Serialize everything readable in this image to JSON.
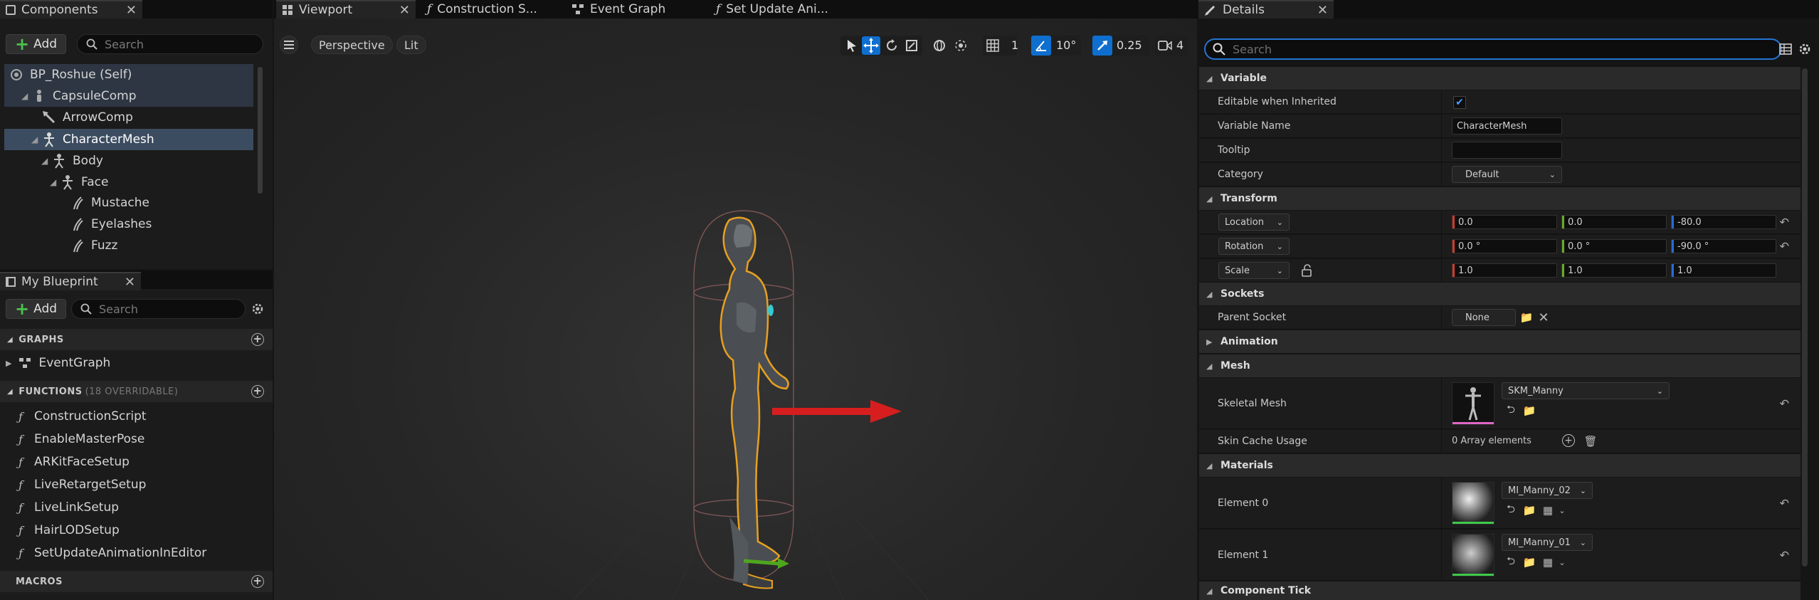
{
  "components_panel": {
    "tab_label": "Components",
    "add_label": "Add",
    "search_placeholder": "Search",
    "tree": [
      {
        "label": "BP_Roshue (Self)"
      },
      {
        "label": "CapsuleComp"
      },
      {
        "label": "ArrowComp"
      },
      {
        "label": "CharacterMesh"
      },
      {
        "label": "Body"
      },
      {
        "label": "Face"
      },
      {
        "label": "Mustache"
      },
      {
        "label": "Eyelashes"
      },
      {
        "label": "Fuzz"
      }
    ]
  },
  "my_blueprint": {
    "tab_label": "My Blueprint",
    "add_label": "Add",
    "search_placeholder": "Search",
    "graphs_header": "GRAPHS",
    "graphs": [
      {
        "label": "EventGraph"
      }
    ],
    "functions_header": "FUNCTIONS",
    "functions_count": "(18 OVERRIDABLE)",
    "functions": [
      {
        "label": "ConstructionScript"
      },
      {
        "label": "EnableMasterPose"
      },
      {
        "label": "ARKitFaceSetup"
      },
      {
        "label": "LiveRetargetSetup"
      },
      {
        "label": "LiveLinkSetup"
      },
      {
        "label": "HairLODSetup"
      },
      {
        "label": "SetUpdateAnimationInEditor"
      }
    ],
    "macros_header": "MACROS"
  },
  "editor_tabs": [
    {
      "label": "Viewport"
    },
    {
      "label": "Construction S..."
    },
    {
      "label": "Event Graph"
    },
    {
      "label": "Set Update Ani..."
    }
  ],
  "viewport": {
    "perspective_label": "Perspective",
    "lit_label": "Lit",
    "grid_snap_value": "1",
    "rotation_snap_value": "10°",
    "scale_snap_value": "0.25",
    "camera_speed_value": "4"
  },
  "details": {
    "tab_label": "Details",
    "search_placeholder": "Search",
    "sections": {
      "variable": "Variable",
      "transform": "Transform",
      "sockets": "Sockets",
      "animation": "Animation",
      "mesh": "Mesh",
      "materials": "Materials",
      "component_tick": "Component Tick"
    },
    "editable_when_inherited_label": "Editable when Inherited",
    "editable_when_inherited": true,
    "variable_name_label": "Variable Name",
    "variable_name": "CharacterMesh",
    "tooltip_label": "Tooltip",
    "tooltip": "",
    "category_label": "Category",
    "category": "Default",
    "location_label": "Location",
    "location": {
      "x": "0.0",
      "y": "0.0",
      "z": "-80.0"
    },
    "rotation_label": "Rotation",
    "rotation": {
      "x": "0.0 °",
      "y": "0.0 °",
      "z": "-90.0 °"
    },
    "scale_label": "Scale",
    "scale": {
      "x": "1.0",
      "y": "1.0",
      "z": "1.0"
    },
    "parent_socket_label": "Parent Socket",
    "parent_socket": "None",
    "skeletal_mesh_label": "Skeletal Mesh",
    "skeletal_mesh": "SKM_Manny",
    "skin_cache_usage_label": "Skin Cache Usage",
    "skin_cache_usage": "0 Array elements",
    "element0_label": "Element 0",
    "element0": "MI_Manny_02",
    "element1_label": "Element 1",
    "element1": "MI_Manny_01"
  },
  "colors": {
    "selection": "#3c4c60",
    "accent_blue": "#0e6fcf",
    "red_axis": "#d03a2a",
    "green_axis": "#6aaa2a",
    "blue_axis": "#2a6ad0",
    "outline_orange": "#e8a020"
  }
}
